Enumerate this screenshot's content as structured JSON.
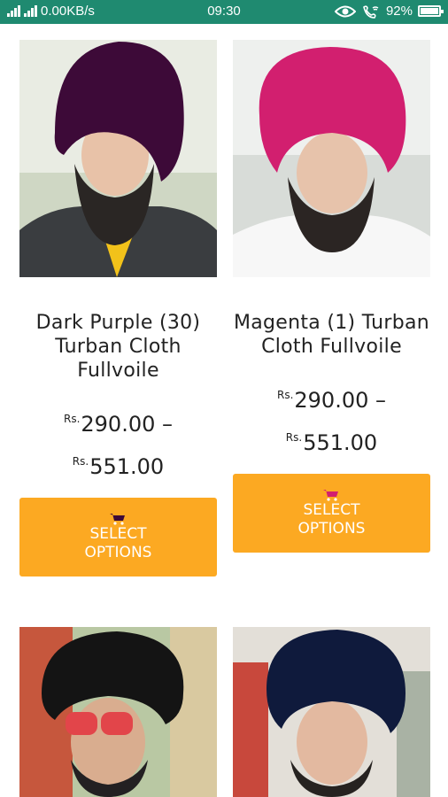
{
  "status_bar": {
    "network_speed": "0.00KB/s",
    "time": "09:30",
    "battery": "92%",
    "battery_level": 0.92,
    "icons": [
      "signal-icon",
      "eye-icon",
      "wifi-call-icon",
      "battery-icon"
    ]
  },
  "products": [
    {
      "name": "Dark Purple (30) Turban Cloth Fullvoile",
      "price_min": "290.00",
      "price_max": "551.00",
      "currency": "Rs.",
      "button": "SELECT OPTIONS",
      "turban_color": "#3d0a38"
    },
    {
      "name": "Magenta (1) Turban Cloth Fullvoile",
      "price_min": "290.00",
      "price_max": "551.00",
      "currency": "Rs.",
      "button": "SELECT OPTIONS",
      "turban_color": "#d21f6f"
    },
    {
      "turban_color": "#141414"
    },
    {
      "turban_color": "#0f1a3c"
    }
  ],
  "colors": {
    "status_bar": "#1f8a70",
    "button": "#fca922"
  }
}
